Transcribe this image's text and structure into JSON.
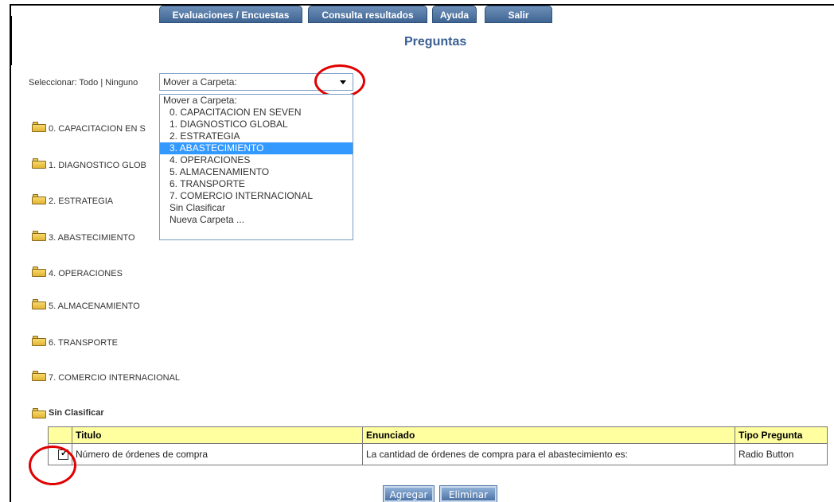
{
  "nav": {
    "evaluaciones": "Evaluaciones / Encuestas",
    "consulta": "Consulta resultados",
    "ayuda": "Ayuda",
    "salir": "Salir"
  },
  "page_title": "Preguntas",
  "selection": {
    "prefix": "Seleccionar:",
    "all": "Todo",
    "separator": "|",
    "none": "Ninguno"
  },
  "move_select": {
    "value": "Mover a Carpeta:",
    "options": [
      "Mover a Carpeta:",
      "0. CAPACITACION EN SEVEN",
      "1. DIAGNOSTICO GLOBAL",
      "2. ESTRATEGIA",
      "3. ABASTECIMIENTO",
      "4. OPERACIONES",
      "5. ALMACENAMIENTO",
      "6. TRANSPORTE",
      "7. COMERCIO INTERNACIONAL",
      "Sin Clasificar",
      "Nueva Carpeta ..."
    ],
    "highlighted": "3. ABASTECIMIENTO"
  },
  "folders": [
    "0. CAPACITACION EN S",
    "1. DIAGNOSTICO GLOB",
    "2. ESTRATEGIA",
    "3. ABASTECIMIENTO",
    "4. OPERACIONES",
    "5. ALMACENAMIENTO",
    "6. TRANSPORTE",
    "7. COMERCIO INTERNACIONAL"
  ],
  "unclassified_folder": "Sin Clasificar",
  "table": {
    "headers": [
      "Titulo",
      "Enunciado",
      "Tipo Pregunta"
    ],
    "rows": [
      {
        "checked": true,
        "titulo": "Número de órdenes de compra",
        "enunciado": "La cantidad de órdenes de compra para el abastecimiento es:",
        "tipo": "Radio Button"
      }
    ]
  },
  "actions": {
    "agregar": "Agregar",
    "eliminar": "Eliminar"
  },
  "colors": {
    "nav_tab": "#4a6f9f",
    "title": "#3a5f93",
    "table_header": "#ffffa0",
    "highlight": "#3399ff",
    "annotation": "#e00000"
  }
}
